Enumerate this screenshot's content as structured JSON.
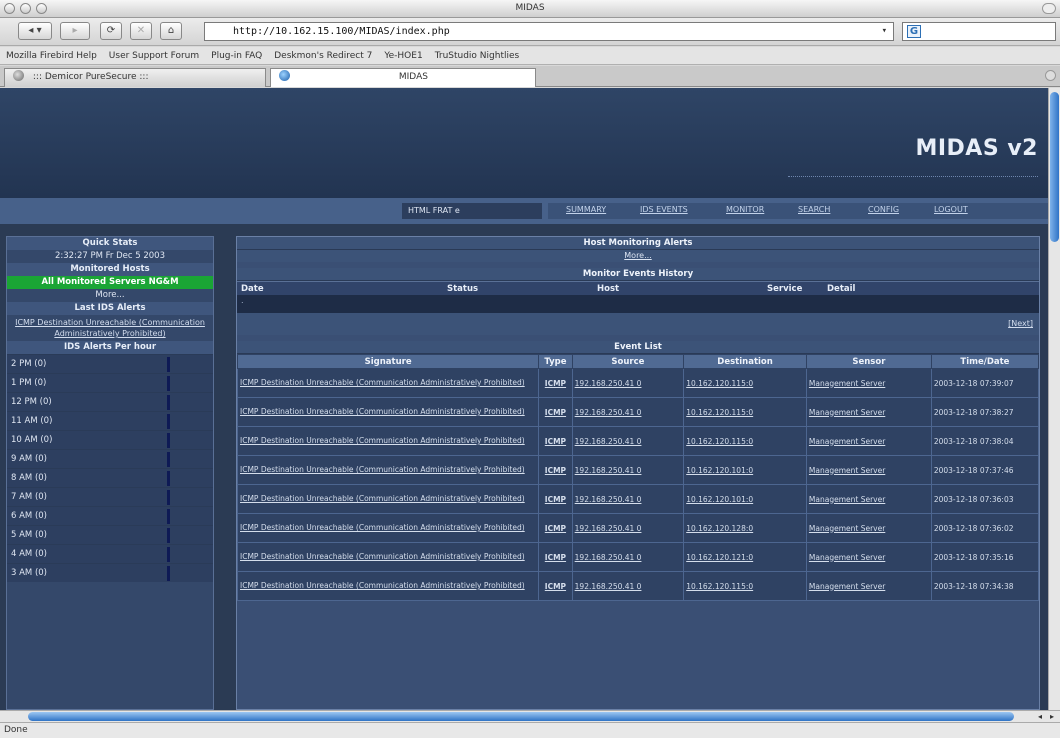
{
  "window": {
    "title": "MIDAS"
  },
  "toolbar": {
    "url": "http://10.162.15.100/MIDAS/index.php",
    "search_logo": "G",
    "buttons": [
      "back-icon",
      "forward-icon",
      "reload-icon",
      "stop-icon",
      "home-icon"
    ]
  },
  "bookmarks": [
    "Mozilla Firebird Help",
    "User Support Forum",
    "Plug-in FAQ",
    "Deskmon's Redirect 7",
    "Ye-HOE1",
    "TruStudio Nightlies"
  ],
  "tabs": [
    {
      "label": "::: Demicor PureSecure :::"
    },
    {
      "label": "MIDAS"
    }
  ],
  "status": "Done",
  "midas": {
    "logo": "MIDAS v2",
    "nav_current": "HTML FRAT e",
    "nav": [
      "SUMMARY",
      "IDS EVENTS",
      "MONITOR",
      "SEARCH",
      "CONFIG",
      "LOGOUT"
    ]
  },
  "sidebar": {
    "quick_stats": "Quick Stats",
    "datetime": "2:32:27 PM Fr Dec 5 2003",
    "monitored_hosts": "Monitored Hosts",
    "all_ok": "All Monitored Servers NG&M",
    "more": "More...",
    "last_ids": "Last IDS Alerts",
    "last_ids_link": "ICMP Destination Unreachable (Communication Administratively Prohibited)",
    "per_hour": "IDS Alerts Per hour",
    "hours": [
      "2 PM (0)",
      "1 PM (0)",
      "12 PM (0)",
      "11 AM (0)",
      "10 AM (0)",
      "9 AM (0)",
      "8 AM (0)",
      "7 AM (0)",
      "6 AM (0)",
      "5 AM (0)",
      "4 AM (0)",
      "3 AM (0)"
    ]
  },
  "host_alerts": {
    "title": "Host Monitoring Alerts",
    "more": "More..."
  },
  "history": {
    "title": "Monitor Events History",
    "cols": [
      "Date",
      "Status",
      "Host",
      "Service",
      "Detail"
    ],
    "empty": ".",
    "next": "[Next]"
  },
  "events": {
    "title": "Event List",
    "cols": [
      "Signature",
      "Type",
      "Source",
      "Destination",
      "Sensor",
      "Time/Date"
    ],
    "rows": [
      {
        "sig": "ICMP Destination Unreachable (Communication Administratively Prohibited)",
        "type": "ICMP",
        "src": "192.168.250.41 0",
        "dst": "10.162.120.115:0",
        "sensor": "Management Server",
        "time": "2003-12-18 07:39:07"
      },
      {
        "sig": "ICMP Destination Unreachable (Communication Administratively Prohibited)",
        "type": "ICMP",
        "src": "192.168.250.41 0",
        "dst": "10.162.120.115:0",
        "sensor": "Management Server",
        "time": "2003-12-18 07:38:27"
      },
      {
        "sig": "ICMP Destination Unreachable (Communication Administratively Prohibited)",
        "type": "ICMP",
        "src": "192.168.250.41 0",
        "dst": "10.162.120.115:0",
        "sensor": "Management Server",
        "time": "2003-12-18 07:38:04"
      },
      {
        "sig": "ICMP Destination Unreachable (Communication Administratively Prohibited)",
        "type": "ICMP",
        "src": "192.168.250.41 0",
        "dst": "10.162.120.101:0",
        "sensor": "Management Server",
        "time": "2003-12-18 07:37:46"
      },
      {
        "sig": "ICMP Destination Unreachable (Communication Administratively Prohibited)",
        "type": "ICMP",
        "src": "192.168.250.41 0",
        "dst": "10.162.120.101:0",
        "sensor": "Management Server",
        "time": "2003-12-18 07:36:03"
      },
      {
        "sig": "ICMP Destination Unreachable (Communication Administratively Prohibited)",
        "type": "ICMP",
        "src": "192.168.250.41 0",
        "dst": "10.162.120.128:0",
        "sensor": "Management Server",
        "time": "2003-12-18 07:36:02"
      },
      {
        "sig": "ICMP Destination Unreachable (Communication Administratively Prohibited)",
        "type": "ICMP",
        "src": "192.168.250.41 0",
        "dst": "10.162.120.121:0",
        "sensor": "Management Server",
        "time": "2003-12-18 07:35:16"
      },
      {
        "sig": "ICMP Destination Unreachable (Communication Administratively Prohibited)",
        "type": "ICMP",
        "src": "192.168.250.41 0",
        "dst": "10.162.120.115:0",
        "sensor": "Management Server",
        "time": "2003-12-18 07:34:38"
      }
    ]
  }
}
